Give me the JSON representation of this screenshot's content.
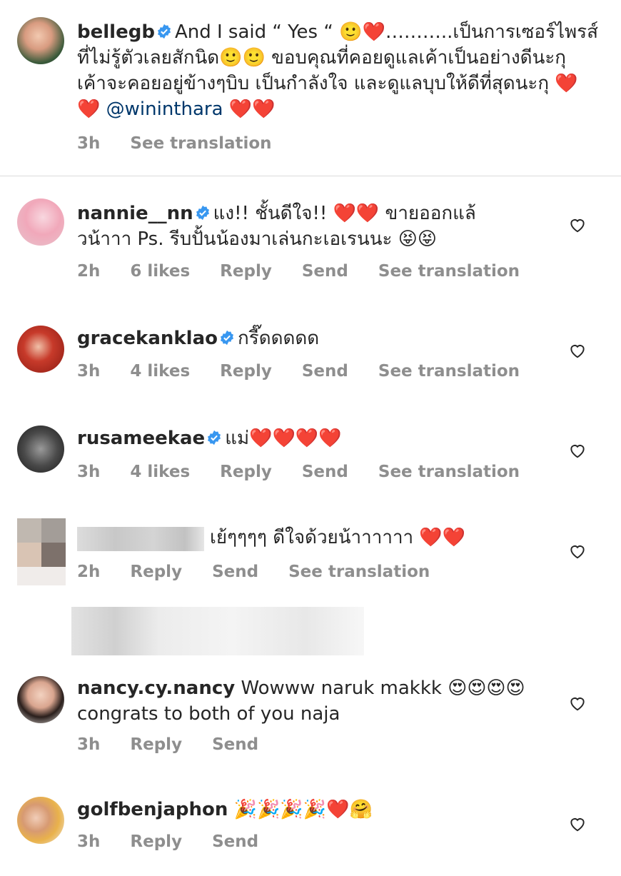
{
  "comments": [
    {
      "username": "bellegb",
      "text": "And I said “ Yes “ 🙂❤️………..เป็นการเซอร์ไพรส์ที่ไม่รู้ตัวเลยสักนิด🙂🙂 ขอบคุณที่คอยดูแลเค้าเป็นอย่างดีนะกุ เค้าจะคอยอยู่ข้างๆบิบ เป็นกำลังใจ และดูแลบุบให้ดีที่สุดนะกุ ❤️❤️",
      "mention": "@wininthara",
      "text_after": " ❤️❤️",
      "time": "3h",
      "see_translation": "See translation"
    },
    {
      "username": "nannie__nn",
      "text": "แง!! ชั้นดีใจ!! ❤️❤️ ขายออกแล้วน้าาา Ps. รีบปั้นน้องมาเล่นกะเอเรนนะ 😝😝",
      "time": "2h",
      "likes": "6 likes",
      "reply": "Reply",
      "send": "Send",
      "see_translation": "See translation"
    },
    {
      "username": "gracekanklao",
      "text": "กรี๊ดดดดด",
      "time": "3h",
      "likes": "4 likes",
      "reply": "Reply",
      "send": "Send",
      "see_translation": "See translation"
    },
    {
      "username": "rusameekae",
      "text": "แม่❤️❤️❤️❤️",
      "time": "3h",
      "likes": "4 likes",
      "reply": "Reply",
      "send": "Send",
      "see_translation": "See translation"
    },
    {
      "text": "เย้ๆๆๆๆ ดีใจด้วยน้าาาาาา ❤️❤️",
      "time": "2h",
      "reply": "Reply",
      "send": "Send",
      "see_translation": "See translation"
    },
    {
      "username": "nancy.cy.nancy",
      "text": "Wowww naruk makkk 😍😍😍😍 congrats to both of you naja",
      "time": "3h",
      "reply": "Reply",
      "send": "Send"
    },
    {
      "username": "golfbenjaphon",
      "text": "🎉🎉🎉🎉❤️🤗",
      "time": "3h",
      "reply": "Reply",
      "send": "Send"
    }
  ],
  "colors": {
    "verified": "#3897f0",
    "heart": "#ed4956",
    "meta": "#8e8e8e",
    "mention": "#00376b"
  },
  "icons": {
    "like": "heart-outline-icon",
    "verified": "verified-badge-icon"
  }
}
